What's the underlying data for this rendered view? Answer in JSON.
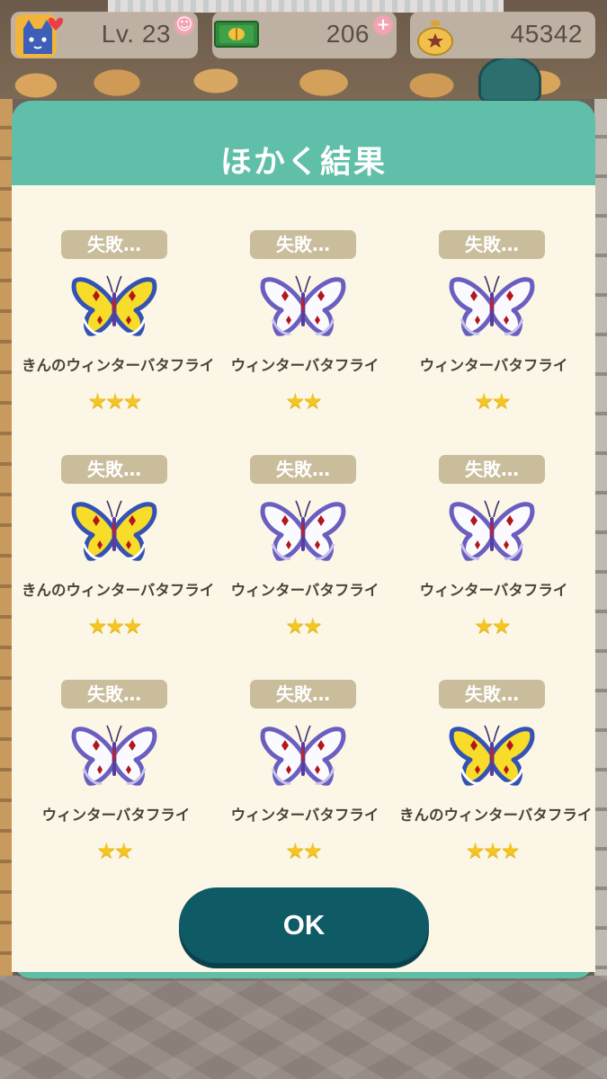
{
  "hud": {
    "level": "Lv. 23",
    "tickets": "206",
    "bells": "45342",
    "icons": {
      "level": "cat-face-icon",
      "tickets": "leaf-ticket-icon",
      "bells": "bell-bag-icon",
      "add": "plus-icon"
    }
  },
  "modal": {
    "title": "ほかく結果",
    "ok_label": "OK"
  },
  "colors": {
    "modal_frame": "#5fbfa8",
    "modal_body": "#fbf6e6",
    "badge": "#c9bd9c",
    "ok_button": "#0e5a65",
    "star": "#f5c524"
  },
  "results": [
    {
      "status": "失敗…",
      "name": "きんのウィンターバタフライ",
      "stars": "★★★",
      "variant": "gold"
    },
    {
      "status": "失敗…",
      "name": "ウィンターバタフライ",
      "stars": "★★",
      "variant": "white"
    },
    {
      "status": "失敗…",
      "name": "ウィンターバタフライ",
      "stars": "★★",
      "variant": "white"
    },
    {
      "status": "失敗…",
      "name": "きんのウィンターバタフライ",
      "stars": "★★★",
      "variant": "gold"
    },
    {
      "status": "失敗…",
      "name": "ウィンターバタフライ",
      "stars": "★★",
      "variant": "white"
    },
    {
      "status": "失敗…",
      "name": "ウィンターバタフライ",
      "stars": "★★",
      "variant": "white"
    },
    {
      "status": "失敗…",
      "name": "ウィンターバタフライ",
      "stars": "★★",
      "variant": "white"
    },
    {
      "status": "失敗…",
      "name": "ウィンターバタフライ",
      "stars": "★★",
      "variant": "white"
    },
    {
      "status": "失敗…",
      "name": "きんのウィンターバタフライ",
      "stars": "★★★",
      "variant": "gold"
    }
  ]
}
